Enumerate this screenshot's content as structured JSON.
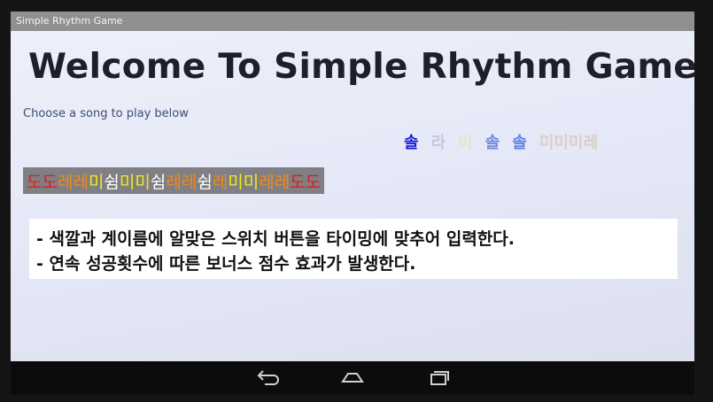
{
  "window": {
    "title": "Simple Rhythm Game"
  },
  "main": {
    "heading": "Welcome To Simple Rhythm Game",
    "subtitle": "Choose a song to play below"
  },
  "falling_notes": [
    {
      "text": "솔",
      "color": "#1a1ad8"
    },
    {
      "text": "라",
      "color": "#c6c8d8"
    },
    {
      "text": "미",
      "color": "#e3e6c4"
    },
    {
      "text": "솔",
      "color": "#6f8ae0"
    },
    {
      "text": "솔",
      "color": "#5f7fe6"
    },
    {
      "text": "미미미레",
      "color": "#d9cfc6"
    }
  ],
  "song": {
    "background": "#7f7f84",
    "notes": [
      {
        "text": "도도",
        "color": "#e81818"
      },
      {
        "text": "레레",
        "color": "#f08a1c"
      },
      {
        "text": "미",
        "color": "#f2ea1a"
      },
      {
        "text": "쉼",
        "color": "#ffffff"
      },
      {
        "text": "미미",
        "color": "#f2ea1a"
      },
      {
        "text": "쉼",
        "color": "#ffffff"
      },
      {
        "text": "레레",
        "color": "#f08a1c"
      },
      {
        "text": "쉼",
        "color": "#ffffff"
      },
      {
        "text": "레",
        "color": "#f08a1c"
      },
      {
        "text": "미미",
        "color": "#f2ea1a"
      },
      {
        "text": "레레",
        "color": "#f08a1c"
      },
      {
        "text": "도도",
        "color": "#e81818"
      }
    ]
  },
  "info": {
    "line1": "- 색깔과 계이름에 알맞은 스위치 버튼을 타이밍에 맞추어 입력한다.",
    "line2": "- 연속 성공횟수에 따른 보너스 점수 효과가 발생한다."
  },
  "navbar": {
    "icons": [
      "back-icon",
      "home-icon",
      "recent-apps-icon"
    ]
  }
}
